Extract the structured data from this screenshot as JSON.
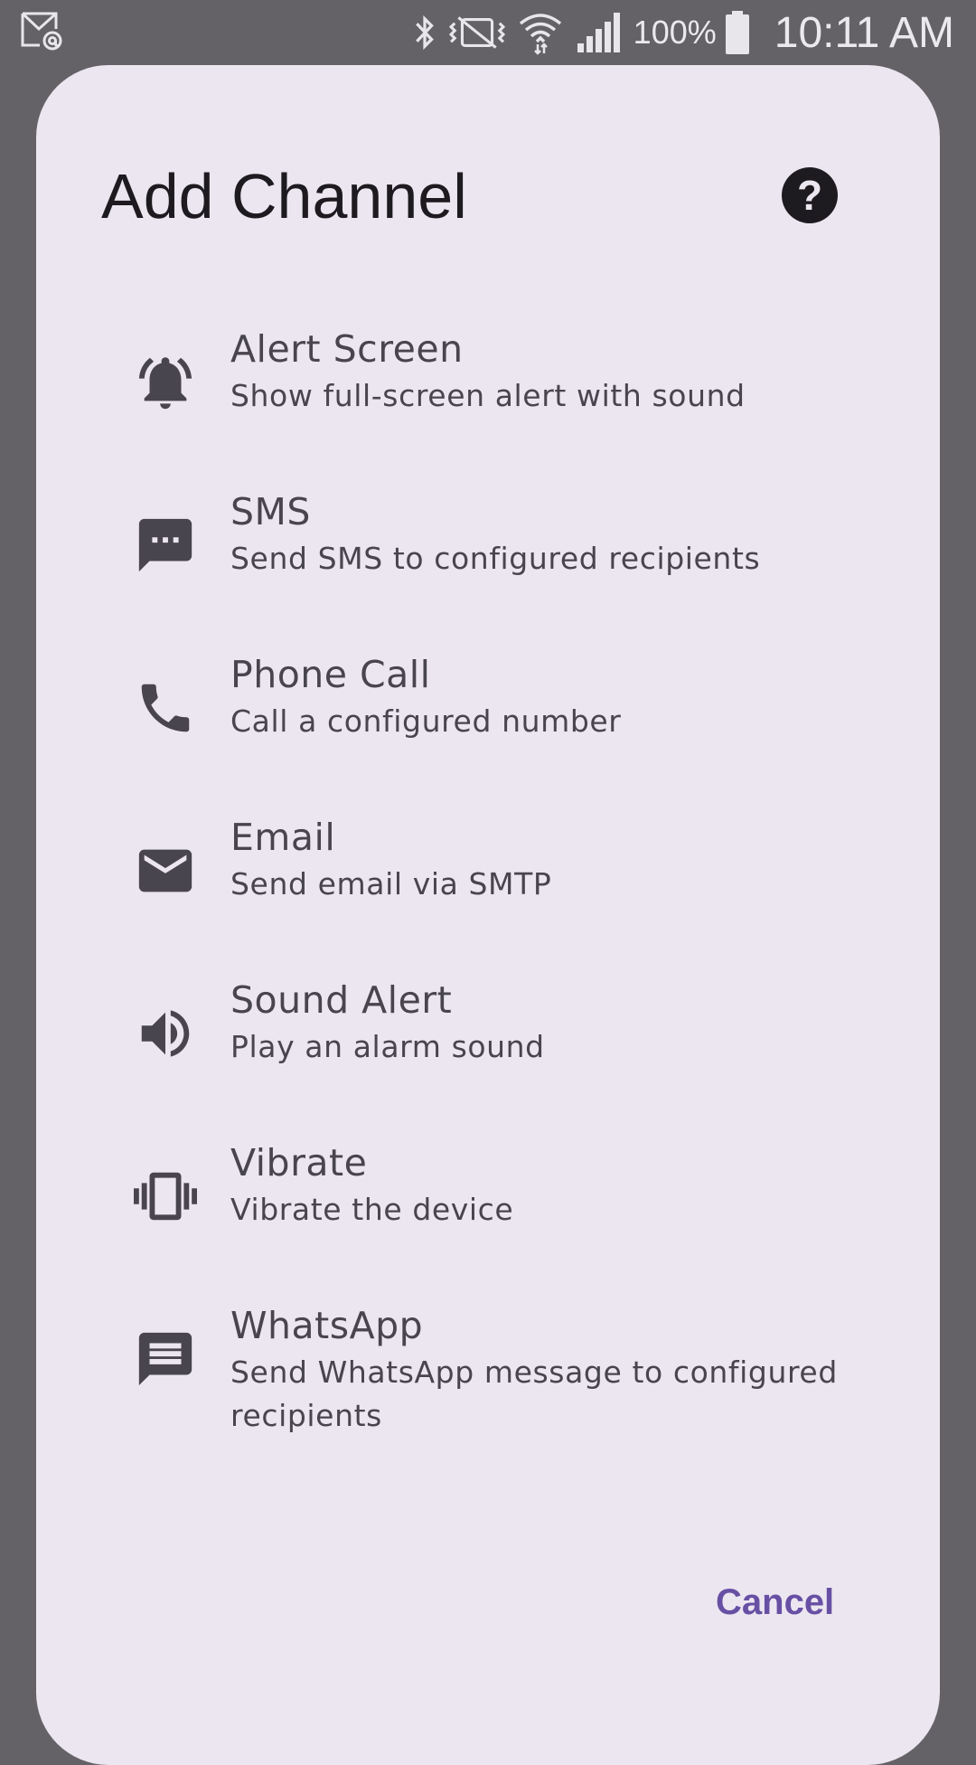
{
  "status_bar": {
    "battery_percent": "100%",
    "time": "10:11 AM",
    "icons": [
      "notification-email-icon",
      "bluetooth-icon",
      "mute-vibrate-icon",
      "wifi-icon",
      "cell-signal-icon",
      "battery-icon"
    ]
  },
  "dialog": {
    "title": "Add Channel",
    "help_label": "?",
    "cancel_label": "Cancel",
    "accent_color": "#6750a4",
    "background_color": "#ece6f0",
    "channels": [
      {
        "icon": "bell-icon",
        "title": "Alert Screen",
        "subtitle": "Show full-screen alert with sound"
      },
      {
        "icon": "sms-icon",
        "title": "SMS",
        "subtitle": "Send SMS to configured recipients"
      },
      {
        "icon": "phone-icon",
        "title": "Phone Call",
        "subtitle": "Call a configured number"
      },
      {
        "icon": "email-icon",
        "title": "Email",
        "subtitle": "Send email via SMTP"
      },
      {
        "icon": "speaker-icon",
        "title": "Sound Alert",
        "subtitle": "Play an alarm sound"
      },
      {
        "icon": "vibrate-icon",
        "title": "Vibrate",
        "subtitle": "Vibrate the device"
      },
      {
        "icon": "message-icon",
        "title": "WhatsApp",
        "subtitle": "Send WhatsApp message to configured recipients"
      }
    ]
  }
}
